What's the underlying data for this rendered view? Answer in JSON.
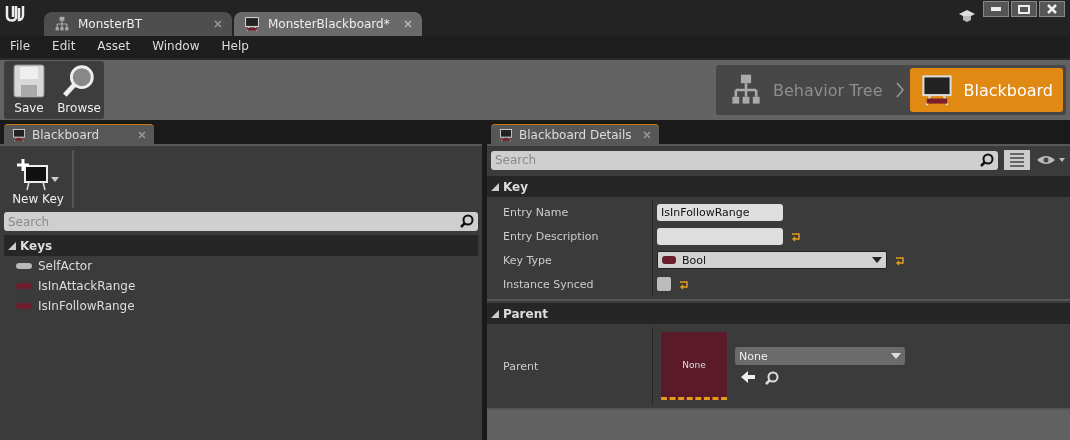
{
  "document_tabs": [
    {
      "label": "MonsterBT",
      "selected": false
    },
    {
      "label": "MonsterBlackboard*",
      "selected": true
    }
  ],
  "menu": [
    "File",
    "Edit",
    "Asset",
    "Window",
    "Help"
  ],
  "toolbar": [
    "Save",
    "Browse"
  ],
  "modes": [
    {
      "label": "Behavior Tree",
      "selected": false
    },
    {
      "label": "Blackboard",
      "selected": true
    }
  ],
  "blackboard_panel": {
    "tab": "Blackboard",
    "new_key": "New Key",
    "search": {
      "placeholder": "Search"
    },
    "section": {
      "title": "Keys",
      "expanded": true
    },
    "keys": [
      {
        "name": "SelfActor",
        "color": "#b8b8b8"
      },
      {
        "name": "IsInAttackRange",
        "color": "#6b1f2e"
      },
      {
        "name": "IsInFollowRange",
        "color": "#6b1f2e"
      }
    ]
  },
  "details_panel": {
    "tab": "Blackboard Details",
    "search": {
      "placeholder": "Search"
    },
    "sections": [
      {
        "title": "Key",
        "expanded": true,
        "rows": [
          {
            "kind": "text",
            "label": "Entry Name",
            "value": "IsInFollowRange",
            "resettable": false
          },
          {
            "kind": "text",
            "label": "Entry Description",
            "value": "",
            "resettable": true
          },
          {
            "kind": "dropdown",
            "label": "Key Type",
            "value": "Bool",
            "color": "#6b1f2e",
            "resettable": true
          },
          {
            "kind": "checkbox",
            "label": "Instance Synced",
            "checked": false,
            "resettable": true
          }
        ]
      },
      {
        "title": "Parent",
        "expanded": true,
        "rows": [
          {
            "kind": "asset",
            "label": "Parent",
            "thumbnail": "None",
            "value": "None"
          }
        ]
      }
    ]
  }
}
